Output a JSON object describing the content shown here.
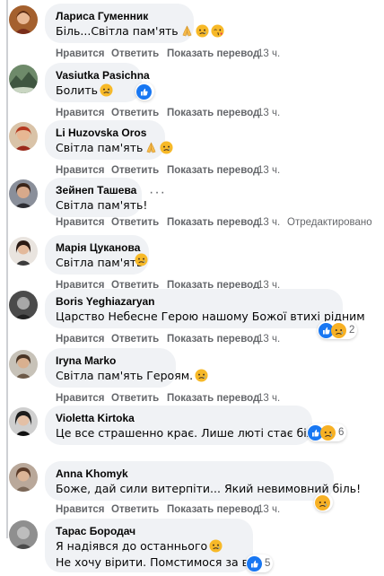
{
  "labels": {
    "like": "Нравится",
    "reply": "Ответить",
    "translate": "Показать перевод",
    "time": "13 ч.",
    "edited": "Отредактировано"
  },
  "comments": [
    {
      "author": "Лариса Гуменник",
      "text": "Біль...Світла пам'ять",
      "emojis": [
        "pray-emoji",
        "sad-emoji",
        "face-emoji"
      ]
    },
    {
      "author": "Vasiutka Pasichna",
      "text": "Болить",
      "emojis": [
        "sad-emoji"
      ],
      "reaction": {
        "icons": [
          "like-reaction"
        ],
        "count": ""
      }
    },
    {
      "author": "Li Huzovska Oros",
      "text": "Світла пам'ять",
      "emojis": [
        "pray-emoji",
        "sad-emoji"
      ]
    },
    {
      "author": "Зейнеп Ташева",
      "text": "Світла пам'ять!",
      "emojis": []
    },
    {
      "author": "Марія Цуканова",
      "text": "Світла пам'ять",
      "emojis": [
        "sad-emoji"
      ]
    },
    {
      "author": "Boris Yeghiazaryan",
      "text": "Царство Небесне Герою нашому Божої втихі рідним",
      "emojis": [],
      "reaction": {
        "icons": [
          "like-reaction",
          "sad-reaction"
        ],
        "count": "2"
      }
    },
    {
      "author": "Iryna Marko",
      "text": "Світла пам'ять Героям.",
      "emojis": [
        "sad-emoji"
      ]
    },
    {
      "author": "Violetta Kirtoka",
      "text": "Це все страшенно крає. Лише люті стає більше",
      "emojis": [],
      "reaction": {
        "icons": [
          "like-reaction",
          "sad-reaction"
        ],
        "count": "6"
      }
    },
    {
      "author": "Anna Khomyk",
      "text": "Боже, дай сили витерпіти... Який невимовний біль!",
      "emojis": [],
      "reaction": {
        "icons": [
          "sad-reaction"
        ],
        "count": ""
      }
    },
    {
      "author": "Тарас Бородач",
      "text": "Я надіявся до останнього",
      "text2": "Не хочу вірити. Помстимося за всіх.",
      "emojis": [
        "sad-emoji"
      ],
      "reaction": {
        "icons": [
          "like-reaction"
        ],
        "count": "5"
      }
    }
  ],
  "colors": {
    "bubble": "#f0f2f5",
    "secondary_text": "#65676b",
    "like_blue": "#1877f2",
    "sad_yellow": "#f7b125"
  }
}
